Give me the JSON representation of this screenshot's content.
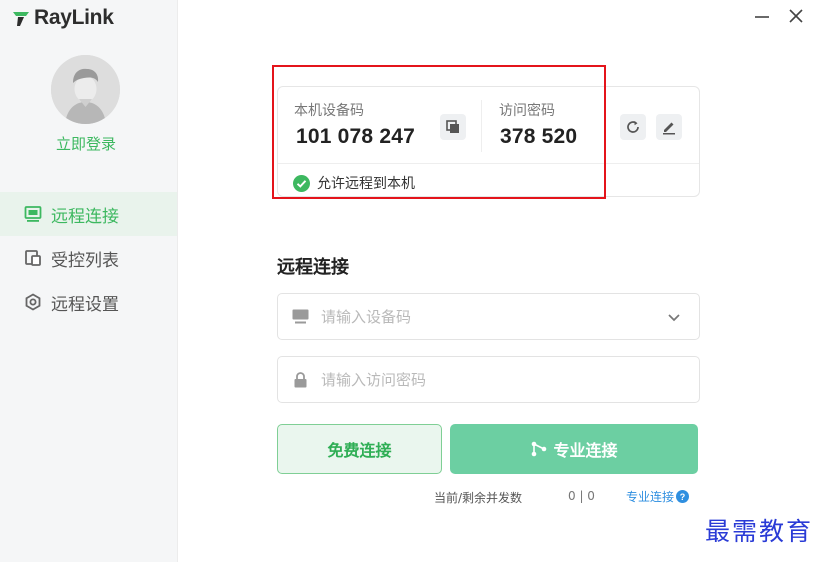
{
  "app": {
    "logo_text": "RayLink"
  },
  "window": {
    "minimize_label": "—",
    "close_label": "✕"
  },
  "sidebar": {
    "login_label": "立即登录",
    "items": [
      {
        "label": "远程连接",
        "icon": "monitor-icon",
        "active": true
      },
      {
        "label": "受控列表",
        "icon": "devices-icon",
        "active": false
      },
      {
        "label": "远程设置",
        "icon": "settings-hex-icon",
        "active": false
      }
    ]
  },
  "device": {
    "code_label": "本机设备码",
    "code_value": "101 078 247",
    "password_label": "访问密码",
    "password_value": "378 520",
    "allow_remote_label": "允许远程到本机",
    "allow_remote_checked": true
  },
  "connect": {
    "title": "远程连接",
    "device_code_placeholder": "请输入设备码",
    "password_placeholder": "请输入访问密码",
    "free_button_label": "免费连接",
    "pro_button_label": "专业连接",
    "concurrency_label": "当前/剩余并发数",
    "concurrency_value": "0 | 0",
    "pro_link_label": "专业连接",
    "help_icon_label": "?"
  },
  "watermark": {
    "text": "最需教育"
  },
  "colors": {
    "accent_green": "#3db860",
    "pro_button_bg": "#6ccfa2",
    "highlight_red": "#e4141b",
    "link_blue": "#2f8fe0",
    "watermark_blue": "#2a3bd6"
  }
}
